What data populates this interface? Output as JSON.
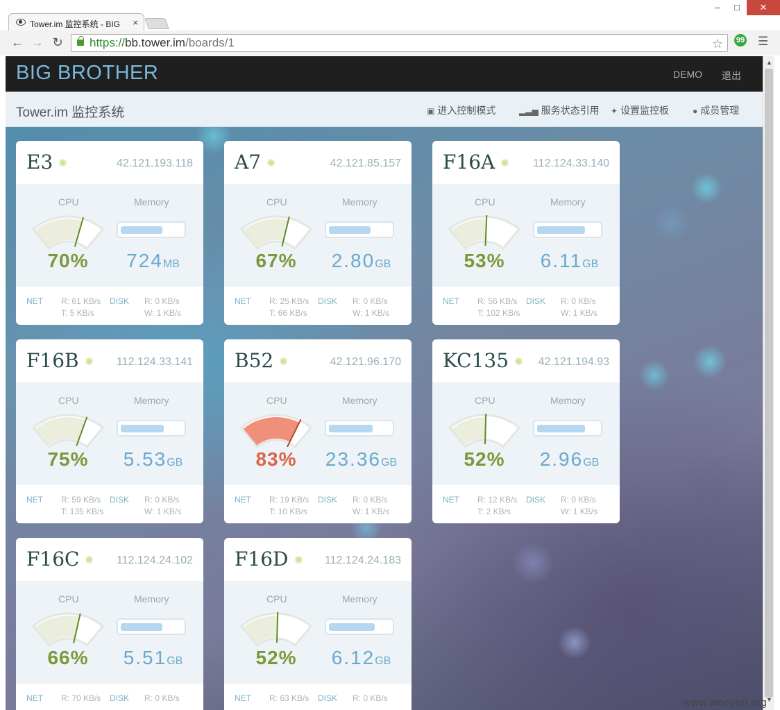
{
  "browser": {
    "tab_title": "Tower.im 监控系统 - BIG",
    "tab_close": "×",
    "url_scheme": "https://",
    "url_host": "bb.tower.im",
    "url_path": "/boards/1",
    "extension_badge": "99",
    "window_minimize": "–",
    "window_maximize": "□",
    "window_close": "✕"
  },
  "header": {
    "brand": "BIG BROTHER",
    "links": [
      "DEMO",
      "退出"
    ]
  },
  "subbar": {
    "title": "Tower.im 监控系统",
    "links": [
      {
        "icon": "monitor-icon",
        "label": "进入控制模式"
      },
      {
        "icon": "signal-icon",
        "label": "服务状态引用"
      },
      {
        "icon": "puzzle-icon",
        "label": "设置监控板"
      },
      {
        "icon": "user-icon",
        "label": "成员管理"
      }
    ]
  },
  "labels": {
    "cpu": "CPU",
    "memory": "Memory",
    "net": "NET",
    "disk": "DISK"
  },
  "colors": {
    "cpu_normal": "#7a9a3a",
    "cpu_warn": "#d9654a",
    "memory": "#6aa9cf",
    "gauge_normal": "#eceedd",
    "gauge_warn": "#f0907a"
  },
  "servers": [
    {
      "name": "E3",
      "ip": "42.121.193.118",
      "cpu": 70,
      "cpu_text": "70%",
      "mem_value": "724",
      "mem_unit": "MB",
      "mem_fill": 0.68,
      "net_r": "R: 61 KB/s",
      "net_t": "T: 5 KB/s",
      "disk_r": "R: 0 KB/s",
      "disk_w": "W: 1 KB/s",
      "warn": false
    },
    {
      "name": "A7",
      "ip": "42.121.85.157",
      "cpu": 67,
      "cpu_text": "67%",
      "mem_value": "2.80",
      "mem_unit": "GB",
      "mem_fill": 0.68,
      "net_r": "R: 25 KB/s",
      "net_t": "T: 66 KB/s",
      "disk_r": "R: 0 KB/s",
      "disk_w": "W: 1 KB/s",
      "warn": false
    },
    {
      "name": "F16A",
      "ip": "112.124.33.140",
      "cpu": 53,
      "cpu_text": "53%",
      "mem_value": "6.11",
      "mem_unit": "GB",
      "mem_fill": 0.78,
      "net_r": "R: 56 KB/s",
      "net_t": "T: 102 KB/s",
      "disk_r": "R: 0 KB/s",
      "disk_w": "W: 1 KB/s",
      "warn": false
    },
    {
      "name": "F16B",
      "ip": "112.124.33.141",
      "cpu": 75,
      "cpu_text": "75%",
      "mem_value": "5.53",
      "mem_unit": "GB",
      "mem_fill": 0.71,
      "net_r": "R: 59 KB/s",
      "net_t": "T: 135 KB/s",
      "disk_r": "R: 0 KB/s",
      "disk_w": "W: 1 KB/s",
      "warn": false
    },
    {
      "name": "B52",
      "ip": "42.121.96.170",
      "cpu": 83,
      "cpu_text": "83%",
      "mem_value": "23.36",
      "mem_unit": "GB",
      "mem_fill": 0.72,
      "net_r": "R: 19 KB/s",
      "net_t": "T: 10 KB/s",
      "disk_r": "R: 0 KB/s",
      "disk_w": "W: 1 KB/s",
      "warn": true
    },
    {
      "name": "KC135",
      "ip": "42.121.194.93",
      "cpu": 52,
      "cpu_text": "52%",
      "mem_value": "2.96",
      "mem_unit": "GB",
      "mem_fill": 0.78,
      "net_r": "R: 12 KB/s",
      "net_t": "T: 2 KB/s",
      "disk_r": "R: 0 KB/s",
      "disk_w": "W: 1 KB/s",
      "warn": false
    },
    {
      "name": "F16C",
      "ip": "112.124.24.102",
      "cpu": 66,
      "cpu_text": "66%",
      "mem_value": "5.51",
      "mem_unit": "GB",
      "mem_fill": 0.68,
      "net_r": "R: 70 KB/s",
      "net_t": "",
      "disk_r": "R: 0 KB/s",
      "disk_w": "",
      "warn": false
    },
    {
      "name": "F16D",
      "ip": "112.124.24.183",
      "cpu": 52,
      "cpu_text": "52%",
      "mem_value": "6.12",
      "mem_unit": "GB",
      "mem_fill": 0.75,
      "net_r": "R: 63 KB/s",
      "net_t": "",
      "disk_r": "R: 0 KB/s",
      "disk_w": "",
      "warn": false
    }
  ],
  "watermark": "www.wooyun.org"
}
